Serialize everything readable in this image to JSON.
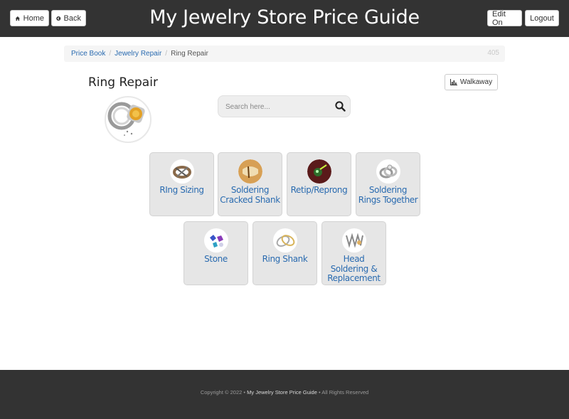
{
  "header": {
    "title": "My Jewelry Store Price Guide",
    "home_label": "Home",
    "back_label": "Back",
    "edit_label": "Edit On",
    "logout_label": "Logout"
  },
  "breadcrumb": {
    "items": [
      "Price Book",
      "Jewelry Repair",
      "Ring Repair"
    ],
    "id": "405"
  },
  "page": {
    "title": "Ring Repair",
    "walkaway_label": "Walkaway"
  },
  "search": {
    "placeholder": "Search here..."
  },
  "tiles": [
    {
      "label": "RIng Sizing",
      "icon": "ring-sizing-icon"
    },
    {
      "label": "Soldering Cracked Shank",
      "icon": "soldering-shank-icon"
    },
    {
      "label": "Retip/Reprong",
      "icon": "retip-icon"
    },
    {
      "label": "Soldering Rings Together",
      "icon": "rings-together-icon"
    },
    {
      "label": "Stone",
      "icon": "stone-icon"
    },
    {
      "label": "Ring Shank",
      "icon": "ring-shank-icon"
    },
    {
      "label": "Head Soldering & Replacement",
      "icon": "head-soldering-icon"
    }
  ],
  "footer": {
    "prefix": "Copyright © 2022 •",
    "brand": "My Jewelry Store Price Guide",
    "suffix": "• All Rights Reserved"
  },
  "colors": {
    "header_bg": "#333333",
    "link": "#2a6bb0",
    "tile_bg": "#e6e6e6",
    "footer_bg": "#333333"
  }
}
